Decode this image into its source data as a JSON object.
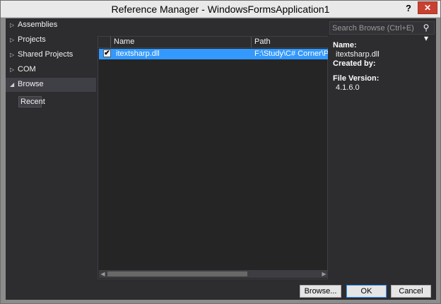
{
  "window": {
    "title": "Reference Manager - WindowsFormsApplication1",
    "help": "?",
    "close": "✕"
  },
  "sidebar": {
    "items": [
      {
        "label": "Assemblies",
        "arrow": "▷"
      },
      {
        "label": "Projects",
        "arrow": "▷"
      },
      {
        "label": "Shared Projects",
        "arrow": "▷"
      },
      {
        "label": "COM",
        "arrow": "▷"
      },
      {
        "label": "Browse",
        "arrow": "◢"
      }
    ],
    "sub_item": "Recent"
  },
  "search": {
    "placeholder": "Search Browse (Ctrl+E)",
    "icon": "⚲ ▾"
  },
  "list": {
    "columns": [
      "Name",
      "Path"
    ],
    "rows": [
      {
        "checked": "✔",
        "name": "itextsharp.dll",
        "path": "F:\\Study\\C# Corner\\PDF\\"
      }
    ]
  },
  "scroll": {
    "left": "◀",
    "right": "▶"
  },
  "details": {
    "name_label": "Name:",
    "name_value": "itextsharp.dll",
    "created_label": "Created by:",
    "version_label": "File Version:",
    "version_value": "4.1.6.0"
  },
  "buttons": {
    "browse": "Browse...",
    "ok": "OK",
    "cancel": "Cancel"
  },
  "colors": {
    "accent": "#3399ff",
    "background": "#2d2d30",
    "close": "#c84031"
  }
}
